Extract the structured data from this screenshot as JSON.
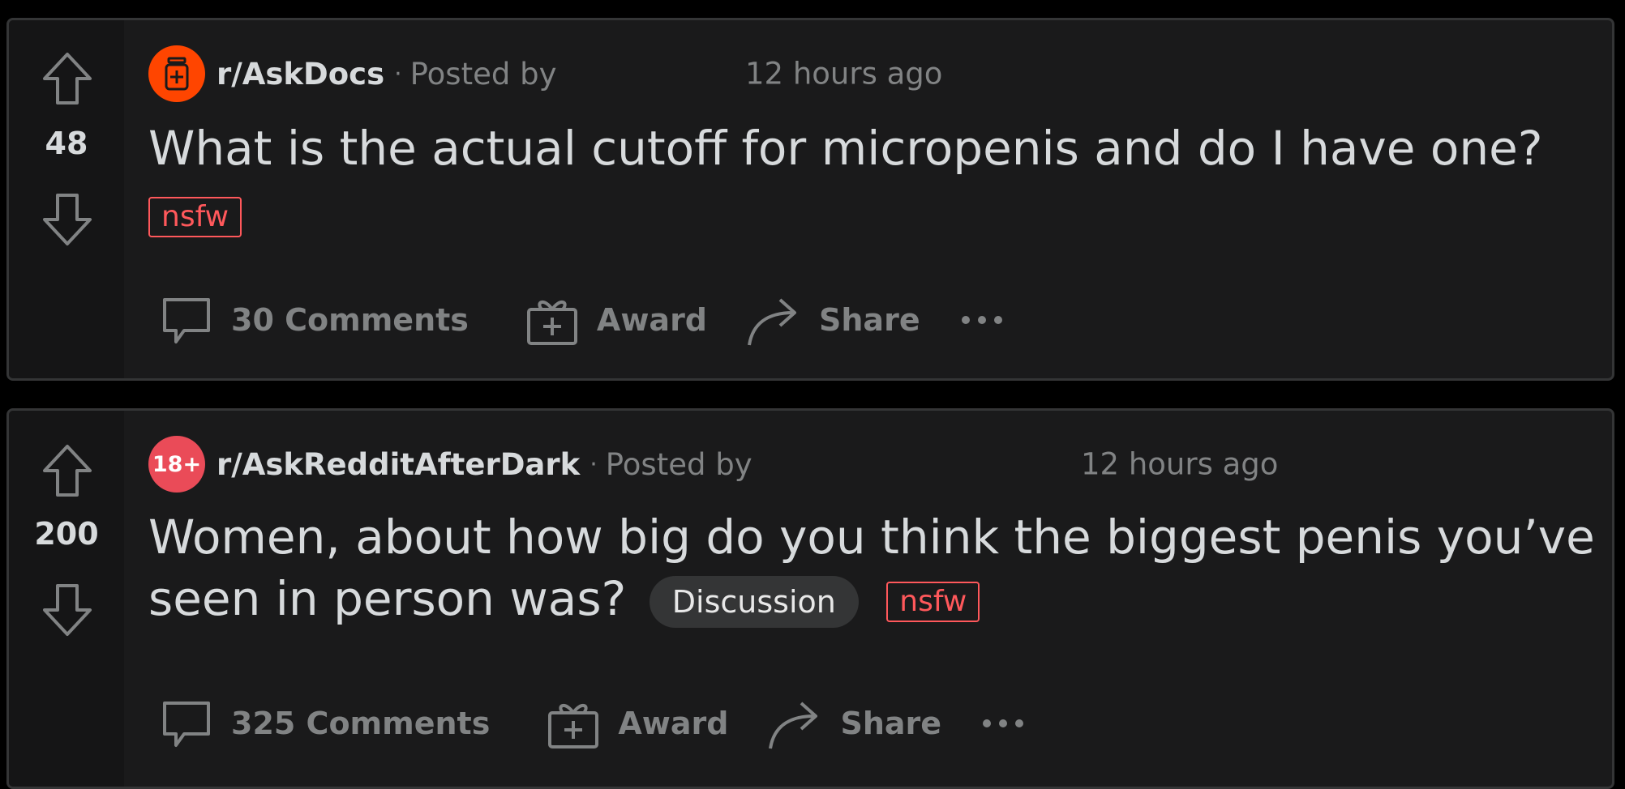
{
  "posts": [
    {
      "score": "48",
      "subreddit": "r/AskDocs",
      "subreddit_icon": "medicine-bottle-icon",
      "subreddit_icon_color": "#ff4500",
      "separator": "·",
      "posted_by": "Posted by",
      "time": "12 hours ago",
      "title": "What is the actual cutoff for micropenis and do I have one?",
      "flair": "",
      "nsfw": "nsfw",
      "comments": "30 Comments",
      "award": "Award",
      "share": "Share"
    },
    {
      "score": "200",
      "subreddit": "r/AskRedditAfterDark",
      "subreddit_icon_text": "18+",
      "subreddit_icon_color": "#ea4b58",
      "separator": "·",
      "posted_by": "Posted by",
      "time": "12 hours ago",
      "title": "Women, about how big do you think the biggest penis you’ve seen in person was?",
      "flair": "Discussion",
      "nsfw": "nsfw",
      "comments": "325 Comments",
      "award": "Award",
      "share": "Share"
    }
  ],
  "colors": {
    "page_background": "#000000",
    "card_background": "#1a1a1b",
    "text_primary": "#d7dadc",
    "text_muted": "#818384",
    "nsfw": "#ff585b"
  }
}
